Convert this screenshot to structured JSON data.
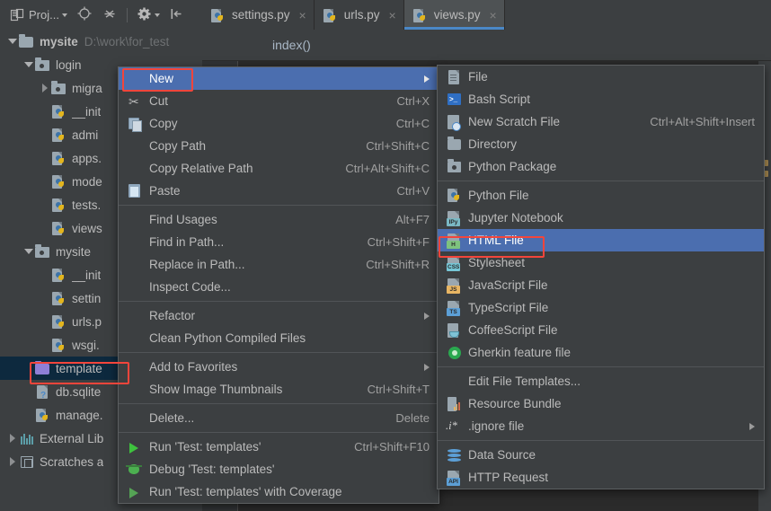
{
  "toolbar": {
    "project_label": "Proj...",
    "icons": [
      "project-icon",
      "locate-icon",
      "collapse-all-icon",
      "settings-icon",
      "hide-icon"
    ]
  },
  "tabs": [
    {
      "label": "settings.py",
      "icon": "python-file-icon",
      "active": false,
      "close": "×"
    },
    {
      "label": "urls.py",
      "icon": "python-file-icon",
      "active": false,
      "close": "×"
    },
    {
      "label": "views.py",
      "icon": "python-file-icon",
      "active": true,
      "close": "×"
    }
  ],
  "breadcrumb": {
    "text": "index()"
  },
  "tree": [
    {
      "label": "mysite",
      "detail": "D:\\work\\for_test",
      "indent": 0,
      "arrow": "down",
      "icon": "folder",
      "bold": true
    },
    {
      "label": "login",
      "indent": 1,
      "arrow": "down",
      "icon": "package"
    },
    {
      "label": "migra",
      "indent": 2,
      "arrow": "right",
      "icon": "package"
    },
    {
      "label": "__init",
      "indent": 2,
      "arrow": "none",
      "icon": "python"
    },
    {
      "label": "admi",
      "indent": 2,
      "arrow": "none",
      "icon": "python"
    },
    {
      "label": "apps.",
      "indent": 2,
      "arrow": "none",
      "icon": "python"
    },
    {
      "label": "mode",
      "indent": 2,
      "arrow": "none",
      "icon": "python"
    },
    {
      "label": "tests.",
      "indent": 2,
      "arrow": "none",
      "icon": "python"
    },
    {
      "label": "views",
      "indent": 2,
      "arrow": "none",
      "icon": "python"
    },
    {
      "label": "mysite",
      "indent": 1,
      "arrow": "down",
      "icon": "package"
    },
    {
      "label": "__init",
      "indent": 2,
      "arrow": "none",
      "icon": "python"
    },
    {
      "label": "settin",
      "indent": 2,
      "arrow": "none",
      "icon": "python"
    },
    {
      "label": "urls.p",
      "indent": 2,
      "arrow": "none",
      "icon": "python"
    },
    {
      "label": "wsgi.",
      "indent": 2,
      "arrow": "none",
      "icon": "python"
    },
    {
      "label": "template",
      "indent": 1,
      "arrow": "none",
      "icon": "folder-purple",
      "selected": true
    },
    {
      "label": "db.sqlite",
      "indent": 1,
      "arrow": "none",
      "icon": "doc-unknown"
    },
    {
      "label": "manage.",
      "indent": 1,
      "arrow": "none",
      "icon": "python"
    },
    {
      "label": "External Lib",
      "indent": 0,
      "arrow": "right",
      "icon": "library"
    },
    {
      "label": "Scratches a",
      "indent": 0,
      "arrow": "right",
      "icon": "scratch"
    }
  ],
  "context_menu": {
    "items": [
      {
        "label": "New",
        "mnemonic": "N",
        "icon": null,
        "shortcut": "",
        "submenu": true,
        "highlighted": true,
        "boxed": true
      },
      {
        "label": "Cut",
        "mnemonic": "t",
        "icon": "cut-icon",
        "shortcut": "Ctrl+X"
      },
      {
        "label": "Copy",
        "mnemonic": "C",
        "icon": "copy-icon",
        "shortcut": "Ctrl+C"
      },
      {
        "label": "Copy Path",
        "mnemonic": "o",
        "icon": null,
        "shortcut": "Ctrl+Shift+C"
      },
      {
        "label": "Copy Relative Path",
        "mnemonic": "y",
        "icon": null,
        "shortcut": "Ctrl+Alt+Shift+C"
      },
      {
        "label": "Paste",
        "mnemonic": "P",
        "icon": "paste-icon",
        "shortcut": "Ctrl+V"
      },
      {
        "separator": true
      },
      {
        "label": "Find Usages",
        "mnemonic": "U",
        "icon": null,
        "shortcut": "Alt+F7"
      },
      {
        "label": "Find in Path...",
        "mnemonic": "a",
        "icon": null,
        "shortcut": "Ctrl+Shift+F"
      },
      {
        "label": "Replace in Path...",
        "mnemonic": "a",
        "icon": null,
        "shortcut": "Ctrl+Shift+R"
      },
      {
        "label": "Inspect Code...",
        "mnemonic": "I",
        "icon": null,
        "shortcut": ""
      },
      {
        "separator": true
      },
      {
        "label": "Refactor",
        "mnemonic": "R",
        "icon": null,
        "shortcut": "",
        "submenu": true
      },
      {
        "label": "Clean Python Compiled Files",
        "icon": null,
        "shortcut": ""
      },
      {
        "separator": true
      },
      {
        "label": "Add to Favorites",
        "mnemonic": "a",
        "icon": null,
        "shortcut": "",
        "submenu": true
      },
      {
        "label": "Show Image Thumbnails",
        "icon": null,
        "shortcut": "Ctrl+Shift+T"
      },
      {
        "separator": true
      },
      {
        "label": "Delete...",
        "mnemonic": "D",
        "icon": null,
        "shortcut": "Delete"
      },
      {
        "separator": true
      },
      {
        "label": "Run 'Test: templates'",
        "mnemonic": "u",
        "icon": "run-icon",
        "shortcut": "Ctrl+Shift+F10"
      },
      {
        "label": "Debug 'Test: templates'",
        "mnemonic": "D",
        "icon": "debug-icon",
        "shortcut": ""
      },
      {
        "label": "Run 'Test: templates' with Coverage",
        "mnemonic": "u",
        "icon": "coverage-icon",
        "shortcut": ""
      }
    ]
  },
  "submenu": {
    "items": [
      {
        "label": "File",
        "icon": "file-icon",
        "shortcut": ""
      },
      {
        "label": "Bash Script",
        "icon": "bash-script-icon",
        "shortcut": ""
      },
      {
        "label": "New Scratch File",
        "icon": "scratch-file-icon",
        "shortcut": "Ctrl+Alt+Shift+Insert"
      },
      {
        "label": "Directory",
        "icon": "directory-icon",
        "shortcut": ""
      },
      {
        "label": "Python Package",
        "icon": "python-package-icon",
        "shortcut": ""
      },
      {
        "separator": true
      },
      {
        "label": "Python File",
        "icon": "python-file-icon",
        "shortcut": ""
      },
      {
        "label": "Jupyter Notebook",
        "icon": "jupyter-notebook-icon",
        "shortcut": ""
      },
      {
        "label": "HTML File",
        "icon": "html-file-icon",
        "shortcut": "",
        "highlighted": true,
        "boxed": true
      },
      {
        "label": "Stylesheet",
        "icon": "stylesheet-icon",
        "shortcut": ""
      },
      {
        "label": "JavaScript File",
        "icon": "javascript-file-icon",
        "shortcut": ""
      },
      {
        "label": "TypeScript File",
        "icon": "typescript-file-icon",
        "shortcut": ""
      },
      {
        "label": "CoffeeScript File",
        "icon": "coffeescript-file-icon",
        "shortcut": ""
      },
      {
        "label": "Gherkin feature file",
        "icon": "gherkin-icon",
        "shortcut": ""
      },
      {
        "separator": true
      },
      {
        "label": "Edit File Templates...",
        "icon": null,
        "shortcut": ""
      },
      {
        "label": "Resource Bundle",
        "icon": "resource-bundle-icon",
        "shortcut": ""
      },
      {
        "label": ".ignore file",
        "icon": "ignore-file-icon",
        "shortcut": "",
        "submenu": true
      },
      {
        "separator": true
      },
      {
        "label": "Data Source",
        "icon": "data-source-icon",
        "shortcut": ""
      },
      {
        "label": "HTTP Request",
        "icon": "http-request-icon",
        "shortcut": ""
      }
    ]
  },
  "colors": {
    "menu_bg": "#3c3f41",
    "editor_bg": "#2b2b2b",
    "highlight": "#4b6eaf",
    "selection": "#0d293e",
    "annotation_red": "#f3453b",
    "tab_active_underline": "#4a88c7",
    "text": "#bbbbbb"
  }
}
